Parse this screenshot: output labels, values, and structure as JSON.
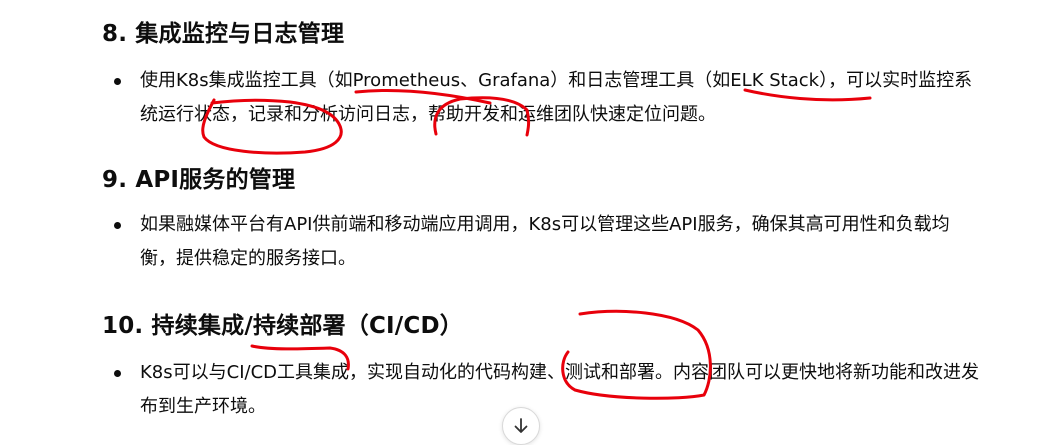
{
  "sections": [
    {
      "heading": "8. 集成监控与日志管理",
      "bullets": [
        "使用K8s集成监控工具（如Prometheus、Grafana）和日志管理工具（如ELK Stack），可以实时监控系统运行状态，记录和分析访问日志，帮助开发和运维团队快速定位问题。"
      ]
    },
    {
      "heading": "9. API服务的管理",
      "bullets": [
        "如果融媒体平台有API供前端和移动端应用调用，K8s可以管理这些API服务，确保其高可用性和负载均衡，提供稳定的服务接口。"
      ]
    },
    {
      "heading": "10. 持续集成/持续部署（CI/CD）",
      "bullets": [
        "K8s可以与CI/CD工具集成，实现自动化的代码构建、测试和部署。内容团队可以更快地将新功能和改进发布到生产环境。"
      ]
    }
  ],
  "annotation_color": "#e8000b",
  "scroll_button": {
    "icon": "arrow-down-icon"
  }
}
